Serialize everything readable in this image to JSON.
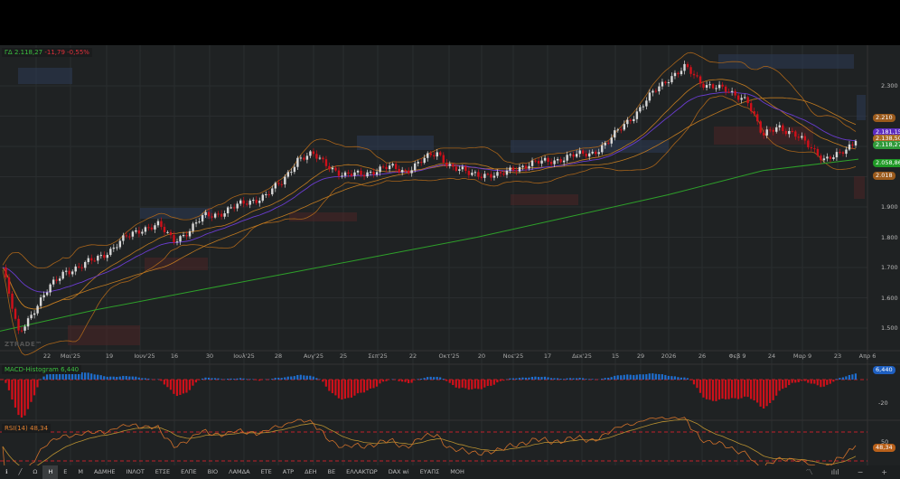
{
  "header": {
    "symbol": "ΓΔ",
    "last": "2.118,27",
    "change": "-11,79",
    "change_pct": "-0,55%"
  },
  "watermark": "ZTRADE™",
  "price_axis": [
    "2.300",
    "1.900",
    "1.800",
    "1.700",
    "1.600",
    "1.500"
  ],
  "badges": [
    {
      "text": "2.210",
      "color": "#9a5a1c"
    },
    {
      "text": "2.181,15",
      "color": "#5b2bc0"
    },
    {
      "text": "2.138,50",
      "color": "#a86a22"
    },
    {
      "text": "2.118,27",
      "color": "#2f9a3a"
    },
    {
      "text": "2.058,86",
      "color": "#1f9a26"
    },
    {
      "text": "2.018",
      "color": "#9a5a1c"
    }
  ],
  "x_labels": [
    "22",
    "Μαι'25",
    "19",
    "Ιουν'25",
    "16",
    "30",
    "Ιουλ'25",
    "28",
    "Αυγ'25",
    "25",
    "Σεπ'25",
    "22",
    "Οκτ'25",
    "20",
    "Νοε'25",
    "17",
    "Δεκ'25",
    "15",
    "29",
    "2026",
    "26",
    "Φεβ 9",
    "24",
    "Μαρ 9",
    "23",
    "Απρ 6"
  ],
  "macd": {
    "label": "MACD-Histogram",
    "value": "6,440",
    "axis": "-20",
    "color_pos": "#1e6fd0",
    "color_neg": "#d0101a"
  },
  "rsi": {
    "label": "RSI(14)",
    "value": "48,34",
    "axis": "50"
  },
  "toolbar": {
    "items": [
      "Ω",
      "Η",
      "Ε",
      "Μ",
      "ΑΔΜΗΕ",
      "ΙΝΛΟΤ",
      "ΕΤΣΕ",
      "ΕΛΠΕ",
      "ΒΙΟ",
      "ΛΑΜΔΑ",
      "ΕΤΕ",
      "ΑΤΡ",
      "ΔΕΗ",
      "ΒΕ",
      "ΕΛΛΑΚΤΩΡ",
      "DAX wi",
      "ΕΥΑΠΣ",
      "ΜΟΗ"
    ],
    "active": "Η"
  },
  "chart_data": {
    "type": "candlestick",
    "title": "ΓΔ daily",
    "ylim": [
      1450,
      2400
    ],
    "closes": [
      1700,
      1480,
      1560,
      1630,
      1690,
      1700,
      1730,
      1760,
      1800,
      1830,
      1840,
      1790,
      1820,
      1870,
      1880,
      1900,
      1920,
      1940,
      1980,
      2060,
      2070,
      2040,
      2000,
      2010,
      2020,
      2030,
      2020,
      2050,
      2080,
      2030,
      2010,
      2010,
      2000,
      2030,
      2040,
      2050,
      2060,
      2070,
      2080,
      2110,
      2170,
      2220,
      2280,
      2330,
      2360,
      2310,
      2300,
      2270,
      2260,
      2130,
      2170,
      2140,
      2100,
      2060,
      2070,
      2118
    ],
    "ma200": [
      1490,
      1560,
      1620,
      1680,
      1740,
      1800,
      1870,
      1940,
      2020,
      2058
    ],
    "colors": {
      "up": "#d8d8d8",
      "down": "#d0101a",
      "ma200": "#2ea02a",
      "ma": "#c07a20",
      "ema": "#6a3cd0",
      "bands": "#a8641a"
    }
  }
}
